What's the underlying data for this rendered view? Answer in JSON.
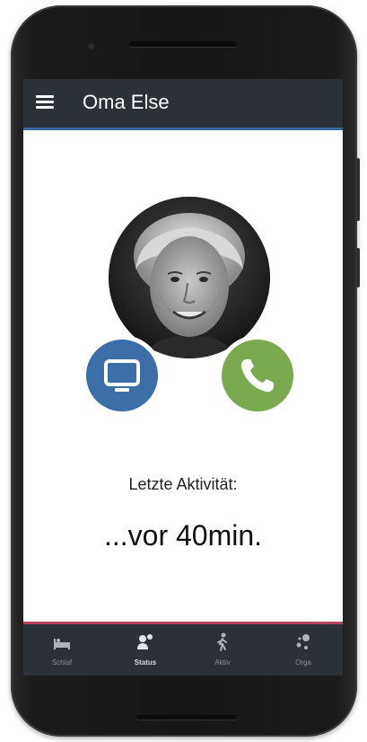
{
  "appbar": {
    "title": "Oma Else",
    "menu_icon": "hamburger-menu-icon"
  },
  "profile": {
    "photo": "elderly-woman-portrait"
  },
  "actions": {
    "video_icon": "tv-monitor-icon",
    "video_color": "#3c6ea8",
    "call_icon": "phone-icon",
    "call_color": "#7aa950"
  },
  "activity": {
    "label": "Letzte Aktivität:",
    "value": "...vor 40min."
  },
  "bottom_nav": {
    "items": [
      {
        "label": "Schlaf",
        "icon": "bed-icon",
        "active": false
      },
      {
        "label": "Status",
        "icon": "person-status-icon",
        "active": true
      },
      {
        "label": "Aktiv",
        "icon": "walking-person-icon",
        "active": false
      },
      {
        "label": "Orga",
        "icon": "organize-icon",
        "active": false
      }
    ]
  },
  "colors": {
    "appbar_bg": "#2c3037",
    "appbar_accent": "#3a6b9a",
    "nav_accent": "#b5435a"
  }
}
